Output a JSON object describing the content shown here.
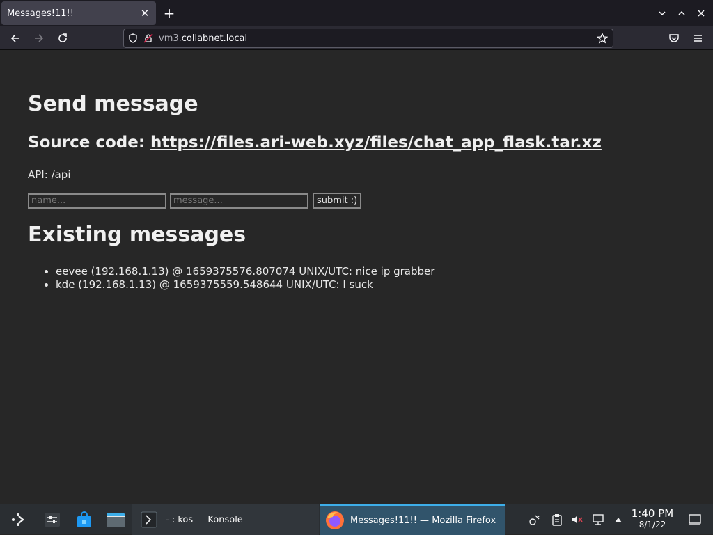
{
  "browser": {
    "tab_title": "Messages!11!!",
    "close_tab_glyph": "✕",
    "new_tab_glyph": "+",
    "url_subdomain": "vm3.",
    "url_domain": "collabnet.local"
  },
  "page": {
    "heading": "Send message",
    "source_label": "Source code: ",
    "source_link": "https://files.ari-web.xyz/files/chat_app_flask.tar.xz",
    "api_label": "API: ",
    "api_link": "/api",
    "name_placeholder": "name...",
    "message_placeholder": "message...",
    "submit_label": "submit :)",
    "existing_heading": "Existing messages",
    "messages": [
      "eevee (192.168.1.13) @ 1659375576.807074 UNIX/UTC: nice ip grabber",
      "kde (192.168.1.13) @ 1659375559.548644 UNIX/UTC: I suck"
    ]
  },
  "taskbar": {
    "konsole_label": "- : kos — Konsole",
    "firefox_label": "Messages!11!! — Mozilla Firefox",
    "time": "1:40 PM",
    "date": "8/1/22"
  },
  "colors": {
    "page_bg": "#272727",
    "active_task_bg": "#31546b",
    "accent": "#3daee9"
  }
}
